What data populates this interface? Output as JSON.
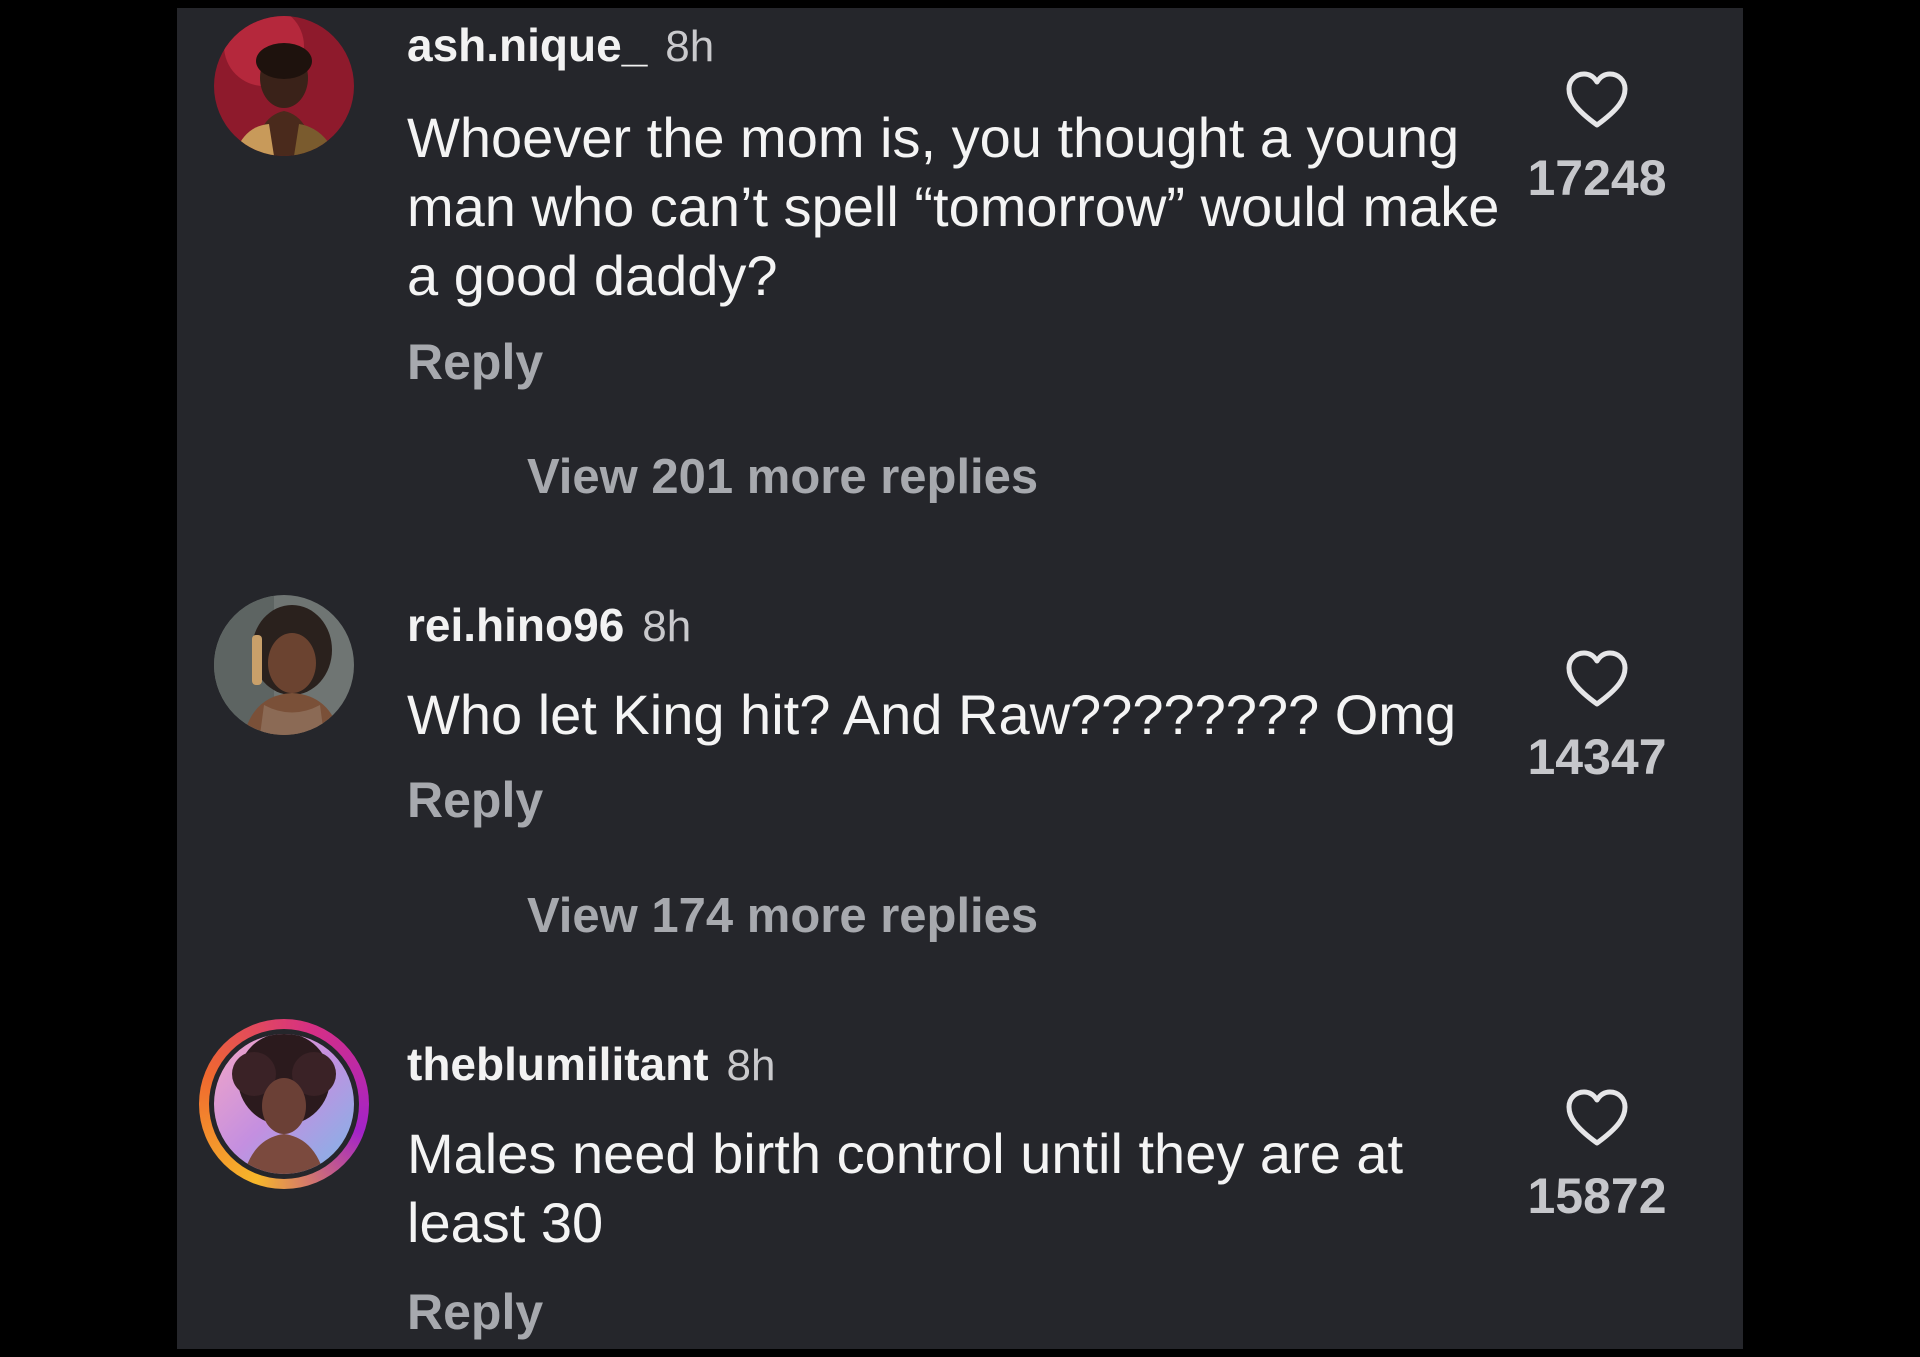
{
  "comments": [
    {
      "username": "ash.nique_",
      "time": "8h",
      "text": "Whoever the mom is, you thought a young man who can’t spell “tomorrow” would make a good daddy?",
      "reply_label": "Reply",
      "view_replies": "View 201 more replies",
      "likes": "17248",
      "avatar_icon": "profile-photo",
      "story_ring": false
    },
    {
      "username": "rei.hino96",
      "time": "8h",
      "text": "Who let King hit? And Raw???????? Omg",
      "reply_label": "Reply",
      "view_replies": "View 174 more replies",
      "likes": "14347",
      "avatar_icon": "profile-photo",
      "story_ring": false
    },
    {
      "username": "theblumilitant",
      "time": "8h",
      "text": "Males need birth control until they are at least 30",
      "reply_label": "Reply",
      "likes": "15872",
      "avatar_icon": "profile-photo",
      "story_ring": true
    }
  ],
  "colors": {
    "background": "#000000",
    "panel": "#25262b",
    "text_primary": "#f4f4f4",
    "text_secondary": "#a7a9ae",
    "story_ring_gradient": [
      "#f7b72a",
      "#f0692f",
      "#d62f84",
      "#a323c9"
    ]
  },
  "icons": {
    "like": "heart-outline-icon"
  }
}
